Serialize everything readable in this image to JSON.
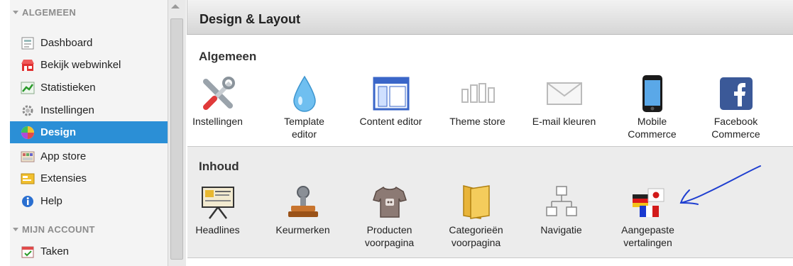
{
  "sidebar": {
    "section_general": "ALGEMEEN",
    "section_account": "MIJN ACCOUNT",
    "items": [
      {
        "label": "Dashboard",
        "icon": "dashboard-icon"
      },
      {
        "label": "Bekijk webwinkel",
        "icon": "store-icon"
      },
      {
        "label": "Statistieken",
        "icon": "chart-icon"
      },
      {
        "label": "Instellingen",
        "icon": "gear-icon"
      },
      {
        "label": "Design",
        "icon": "color-wheel-icon",
        "active": true
      },
      {
        "label": "App store",
        "icon": "app-store-icon"
      },
      {
        "label": "Extensies",
        "icon": "extensions-icon"
      },
      {
        "label": "Help",
        "icon": "help-icon"
      },
      {
        "label": "Taken",
        "icon": "calendar-icon"
      }
    ]
  },
  "main": {
    "title": "Design & Layout",
    "algemeen": {
      "title": "Algemeen",
      "tools": [
        {
          "label": "Instellingen",
          "icon": "tools-icon"
        },
        {
          "label": "Template\neditor",
          "icon": "drop-icon"
        },
        {
          "label": "Content editor",
          "icon": "layout-icon"
        },
        {
          "label": "Theme store",
          "icon": "columns-icon"
        },
        {
          "label": "E-mail kleuren",
          "icon": "envelope-icon"
        },
        {
          "label": "Mobile\nCommerce",
          "icon": "phone-icon"
        },
        {
          "label": "Facebook\nCommerce",
          "icon": "facebook-icon"
        }
      ]
    },
    "inhoud": {
      "title": "Inhoud",
      "tools": [
        {
          "label": "Headlines",
          "icon": "presentation-icon"
        },
        {
          "label": "Keurmerken",
          "icon": "stamp-icon"
        },
        {
          "label": "Producten\nvoorpagina",
          "icon": "shirt-icon"
        },
        {
          "label": "Categorieën\nvoorpagina",
          "icon": "folder-icon"
        },
        {
          "label": "Navigatie",
          "icon": "sitemap-icon"
        },
        {
          "label": "Aangepaste\nvertalingen",
          "icon": "flags-icon"
        }
      ]
    }
  },
  "colors": {
    "active": "#2b8fd6",
    "annotation": "#1f3fd0"
  }
}
